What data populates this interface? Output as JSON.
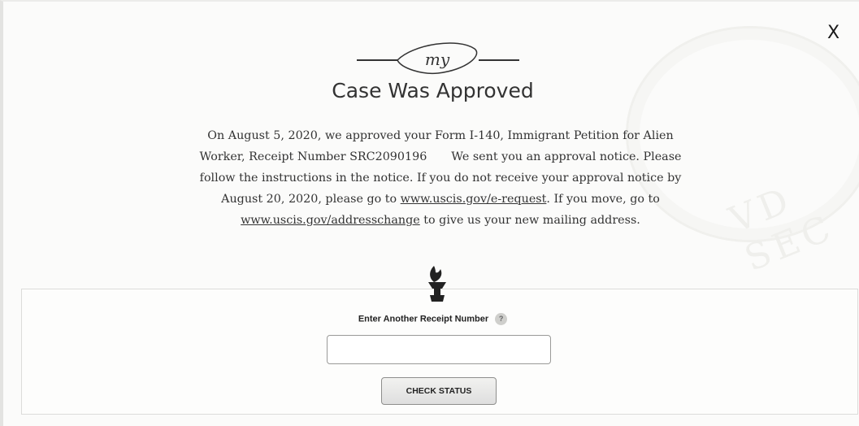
{
  "dialog": {
    "close_label": "X",
    "logo_text": "my",
    "heading": "Case Was Approved"
  },
  "message": {
    "part1": "On August 5, 2020, we approved your Form I-140, Immigrant Petition for Alien Worker, Receipt Number SRC2090196",
    "part2": "We sent you an approval notice. Please follow the instructions in the notice. If you do not receive your approval notice by August 20, 2020, please go to",
    "link1": "www.uscis.gov/e-request",
    "part3": ". If you move, go to",
    "link2": "www.uscis.gov/addresschange",
    "part4": "to give us your new mailing address."
  },
  "form": {
    "label": "Enter Another Receipt Number",
    "help_label": "?",
    "input_value": "",
    "input_placeholder": "",
    "button_label": "CHECK STATUS"
  },
  "background": {
    "seal_text": "VD SEC"
  },
  "colors": {
    "text": "#333333",
    "page": "#fbfbfa",
    "button": "#e6e6e4"
  }
}
